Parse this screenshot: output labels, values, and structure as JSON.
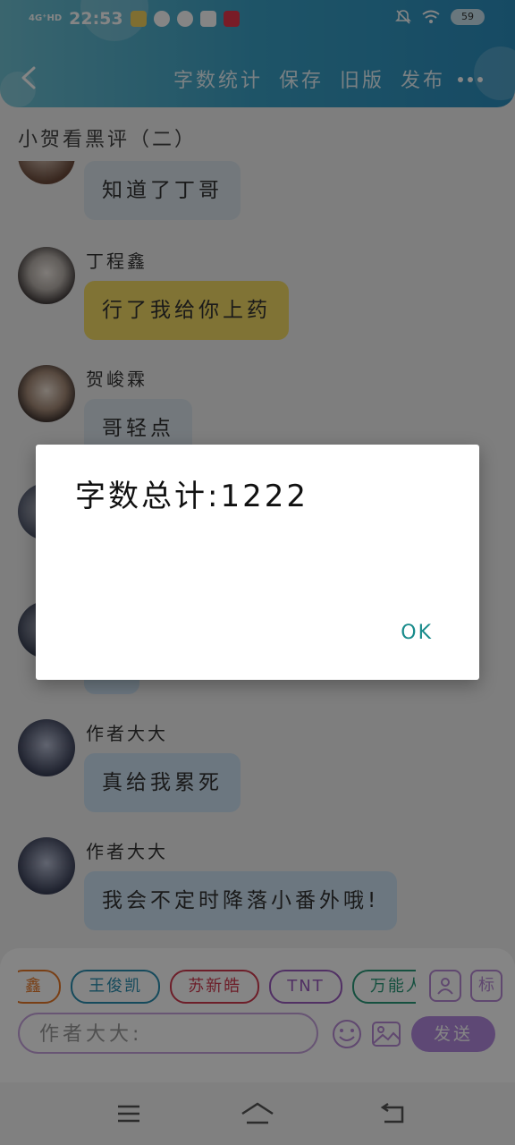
{
  "status_bar": {
    "network": "4G⁺HD",
    "time": "22:53",
    "battery": "59"
  },
  "toolbar": {
    "word_count": "字数统计",
    "save": "保存",
    "old_version": "旧版",
    "publish": "发布"
  },
  "work_title": "小贺看黑评（二）",
  "messages": [
    {
      "sender": "",
      "text": "知道了丁哥",
      "bubble_color": "#dce6ee"
    },
    {
      "sender": "丁程鑫",
      "text": "行了我给你上药",
      "bubble_color": "#f5dc66"
    },
    {
      "sender": "贺峻霖",
      "text": "哥轻点",
      "bubble_color": "#dce6ee"
    },
    {
      "sender": "",
      "text": "",
      "bubble_color": "#cfe4f6"
    },
    {
      "sender": "",
      "text": "",
      "bubble_color": "#cfe4f6"
    },
    {
      "sender": "作者大大",
      "text": "真给我累死",
      "bubble_color": "#cfe4f6"
    },
    {
      "sender": "作者大大",
      "text": "我会不定时降落小番外哦!",
      "bubble_color": "#cfe4f6"
    }
  ],
  "role_chips": [
    {
      "label": "鑫",
      "color": "#e87a2a"
    },
    {
      "label": "王俊凯",
      "color": "#2a8fb0"
    },
    {
      "label": "苏新皓",
      "color": "#d13b50"
    },
    {
      "label": "TNT",
      "color": "#9b5cc0"
    },
    {
      "label": "万能人物",
      "color": "#2a9a7a"
    }
  ],
  "tag_button": "标",
  "input": {
    "placeholder": "作者大大:"
  },
  "send_label": "发送",
  "dialog": {
    "message": "字数总计:1222",
    "ok_label": "OK"
  },
  "colors": {
    "header_start": "#6fc2d4",
    "header_end": "#2b8fbf",
    "send_button": "#b48ae0",
    "dialog_ok": "#188b8b"
  }
}
